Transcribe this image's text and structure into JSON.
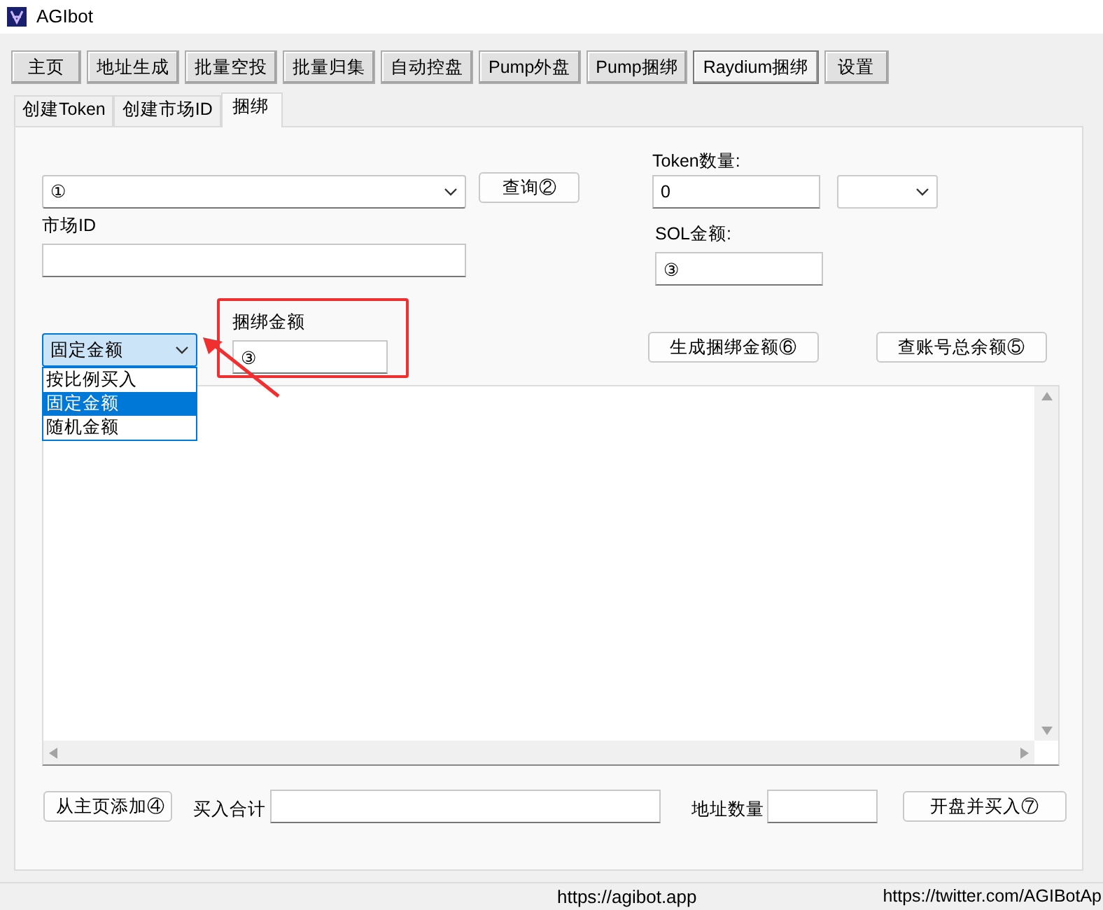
{
  "window": {
    "title": "AGIbot"
  },
  "main_tabs": [
    {
      "label": "主页",
      "selected": false
    },
    {
      "label": "地址生成",
      "selected": false
    },
    {
      "label": "批量空投",
      "selected": false
    },
    {
      "label": "批量归集",
      "selected": false
    },
    {
      "label": "自动控盘",
      "selected": false
    },
    {
      "label": "Pump外盘",
      "selected": false
    },
    {
      "label": "Pump捆绑",
      "selected": false
    },
    {
      "label": "Raydium捆绑",
      "selected": true
    },
    {
      "label": "设置",
      "selected": false
    }
  ],
  "sub_tabs": [
    {
      "label": "创建Token",
      "selected": false
    },
    {
      "label": "创建市场ID",
      "selected": false
    },
    {
      "label": "捆绑",
      "selected": true
    }
  ],
  "form": {
    "pool_combo": {
      "value": "①"
    },
    "query_button": "查询②",
    "token_amount": {
      "label": "Token数量:",
      "value": "0"
    },
    "market_id": {
      "label": "市场ID"
    },
    "sol_amount": {
      "label": "SOL金额:",
      "value": "③"
    },
    "mode_combo": {
      "value": "固定金额",
      "expanded": true,
      "options": [
        {
          "label": "按比例买入",
          "selected": false
        },
        {
          "label": "固定金额",
          "selected": true
        },
        {
          "label": "随机金额",
          "selected": false
        }
      ]
    },
    "bundle_amount": {
      "label": "捆绑金额",
      "value": "③"
    },
    "buttons": [
      "生成捆绑金额⑥",
      "查账号总余额⑤"
    ]
  },
  "bottom": {
    "add_button": "从主页添加④",
    "total_label": "买入合计",
    "count_label": "地址数量",
    "open_button": "开盘并买入⑦"
  },
  "status_bar": [
    "https://agibot.app",
    "https://twitter.com/AGIBotAp"
  ]
}
